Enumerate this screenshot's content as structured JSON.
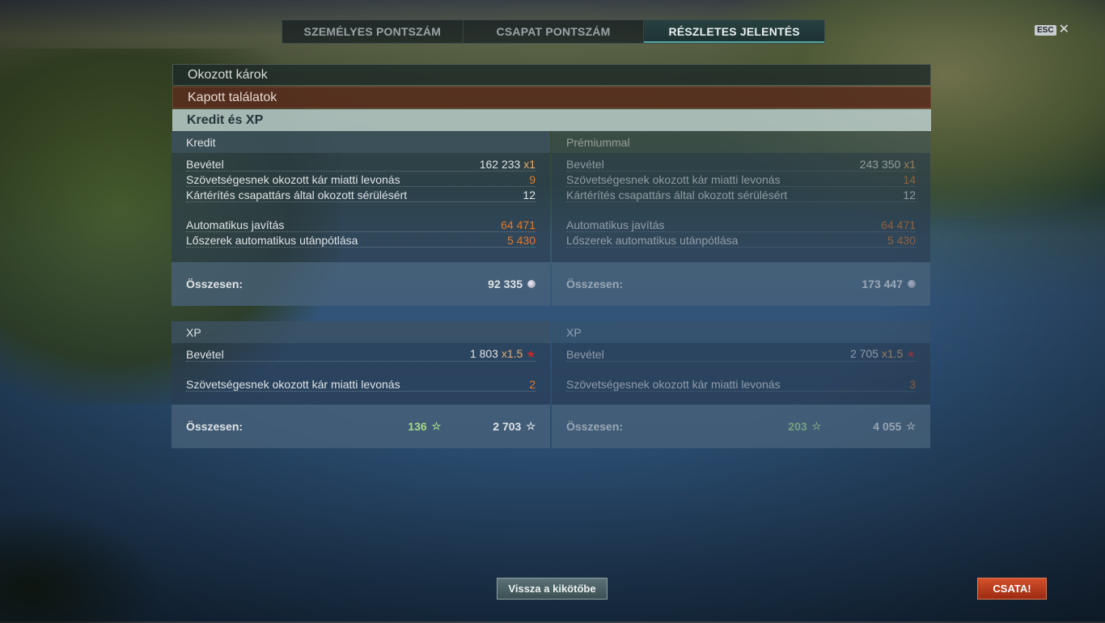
{
  "tabs": [
    {
      "label": "SZEMÉLYES PONTSZÁM"
    },
    {
      "label": "CSAPAT PONTSZÁM"
    },
    {
      "label": "RÉSZLETES JELENTÉS"
    }
  ],
  "close": {
    "key": "ESC",
    "icon": "close-icon"
  },
  "sections": {
    "damage_dealt": "Okozott károk",
    "hits_received": "Kapott találatok",
    "credits_xp": "Kredit és XP"
  },
  "credits": {
    "standard": {
      "title": "Kredit",
      "income_label": "Bevétel",
      "income_value": "162 233",
      "income_mult": "x1",
      "ally_damage_label": "Szövetségesnek okozott kár miatti levonás",
      "ally_damage_value": "9",
      "compensation_label": "Kártérítés csapattárs által okozott sérülésért",
      "compensation_value": "12",
      "auto_repair_label": "Automatikus javítás",
      "auto_repair_value": "64 471",
      "auto_resupply_label": "Lőszerek automatikus utánpótlása",
      "auto_resupply_value": "5 430",
      "total_label": "Összesen:",
      "total_value": "92 335"
    },
    "premium": {
      "title": "Prémiummal",
      "income_label": "Bevétel",
      "income_value": "243 350",
      "income_mult": "x1",
      "ally_damage_label": "Szövetségesnek okozott kár miatti levonás",
      "ally_damage_value": "14",
      "compensation_label": "Kártérítés csapattárs által okozott sérülésért",
      "compensation_value": "12",
      "auto_repair_label": "Automatikus javítás",
      "auto_repair_value": "64 471",
      "auto_resupply_label": "Lőszerek automatikus utánpótlása",
      "auto_resupply_value": "5 430",
      "total_label": "Összesen:",
      "total_value": "173 447"
    }
  },
  "xp": {
    "standard": {
      "title": "XP",
      "income_label": "Bevétel",
      "income_value": "1 803",
      "income_mult": "x1.5",
      "ally_damage_label": "Szövetségesnek okozott kár miatti levonás",
      "ally_damage_value": "2",
      "total_label": "Összesen:",
      "total_free_xp": "136",
      "total_value": "2 703"
    },
    "premium": {
      "title": "XP",
      "income_label": "Bevétel",
      "income_value": "2 705",
      "income_mult": "x1.5",
      "ally_damage_label": "Szövetségesnek okozott kár miatti levonás",
      "ally_damage_value": "3",
      "total_label": "Összesen:",
      "total_free_xp": "203",
      "total_value": "4 055"
    }
  },
  "buttons": {
    "back": "Vissza a kikötőbe",
    "battle": "CSATA!"
  },
  "colors": {
    "accent": "#4fa5a0",
    "deduction": "#e2792a",
    "free_xp": "#a7d88a",
    "battle": "#c4401e"
  }
}
